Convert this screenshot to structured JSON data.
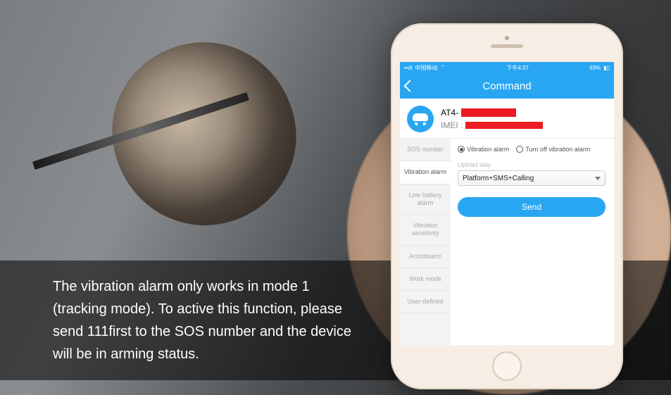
{
  "caption": "The vibration alarm only works in mode 1 (tracking mode). To active this function, please send 111first to the SOS number and the device will be in arming status.",
  "status_bar": {
    "carrier": "中国移动",
    "signal_icon": "signal-icon",
    "wifi_icon": "wifi-icon",
    "time": "下午4:37",
    "battery_pct": "93%",
    "battery_icon": "battery-icon"
  },
  "header": {
    "title": "Command",
    "back_icon": "chevron-left-icon"
  },
  "device": {
    "name_prefix": "AT4-",
    "imei_label": "IMEI :",
    "icon": "car-icon"
  },
  "side_tabs": [
    "SOS number",
    "Vibration alarm",
    "Low battery alarm",
    "Vibration sensitivity",
    "Arm/disarm",
    "Work mode",
    "User-defined"
  ],
  "panel": {
    "radio_on": "Vibration alarm",
    "radio_off": "Turn off vibration alarm",
    "upload_label": "Upload way",
    "upload_value": "Platform+SMS+Calling",
    "send_label": "Send"
  }
}
